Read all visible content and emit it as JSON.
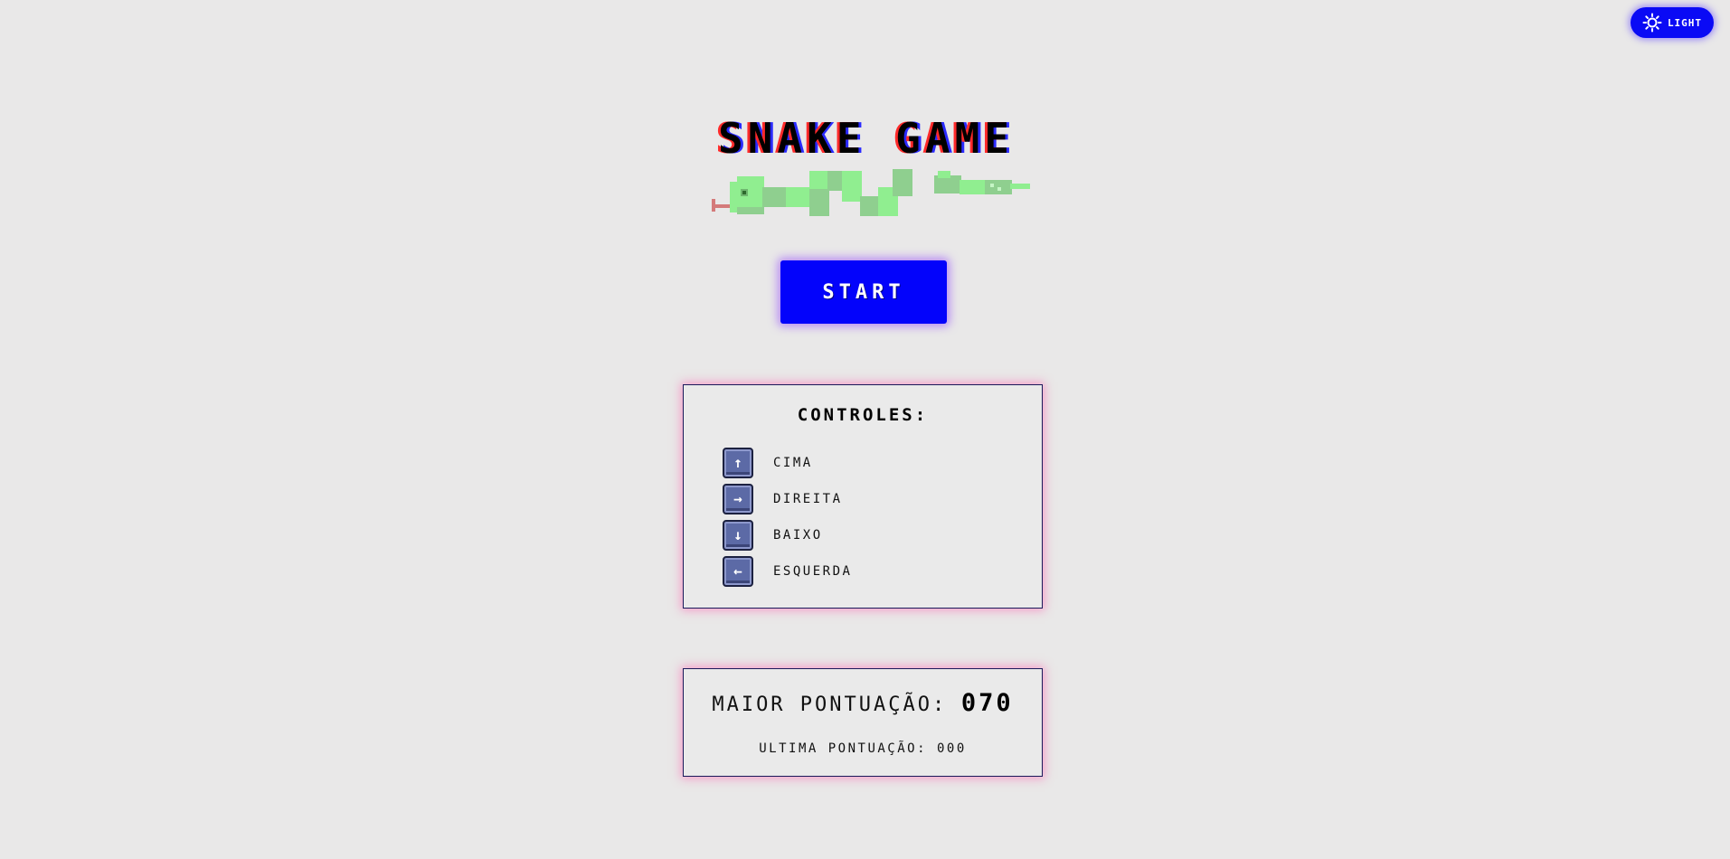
{
  "theme_toggle": {
    "label": "LIGHT",
    "icon": "sun-icon"
  },
  "title": "SNAKE GAME",
  "start_button": {
    "label": "START"
  },
  "controls": {
    "title": "CONTROLES:",
    "items": [
      {
        "key": "↑",
        "icon": "arrow-up-key-icon",
        "label": "CIMA"
      },
      {
        "key": "→",
        "icon": "arrow-right-key-icon",
        "label": "DIREITA"
      },
      {
        "key": "↓",
        "icon": "arrow-down-key-icon",
        "label": "BAIXO"
      },
      {
        "key": "←",
        "icon": "arrow-left-key-icon",
        "label": "ESQUERDA"
      }
    ]
  },
  "scores": {
    "high_label": "MAIOR PONTUAÇÃO:",
    "high_value": "070",
    "last_label": "ULTIMA PONTUAÇÃO:",
    "last_value": "000"
  },
  "colors": {
    "background": "#e9e8e8",
    "accent_blue": "#0303fb",
    "snake_light": "#90ee90",
    "snake_dark": "#8fcf8f",
    "tongue": "#d47a7a",
    "panel_glow": "#ff50aa"
  }
}
